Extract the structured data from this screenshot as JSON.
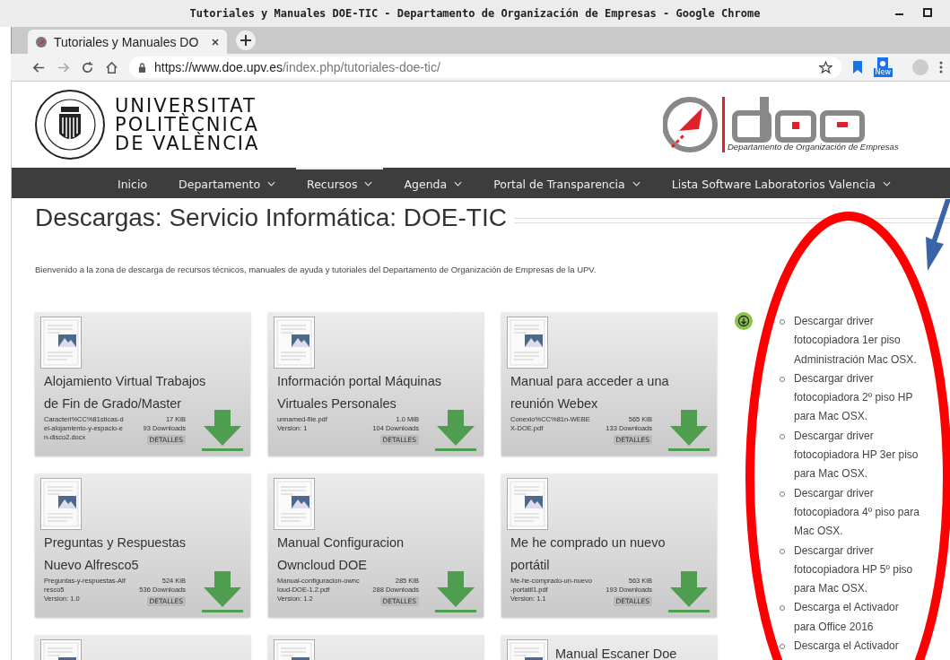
{
  "window": {
    "title": "Tutoriales y Manuales DOE-TIC - Departamento de Organización de Empresas - Google Chrome"
  },
  "tabs": [
    {
      "label": "Tutoriales y Manuales DO",
      "selected": true
    }
  ],
  "address_bar": {
    "host": "https://www.doe.upv.es",
    "path": "/index.php/tutoriales-doe-tic/"
  },
  "extension_badge": "New",
  "header": {
    "university": [
      "UNIVERSITAT",
      "POLITÈCNICA",
      "DE VALÈNCIA"
    ],
    "department": "Departamento de Organización de Empresas"
  },
  "nav": [
    {
      "label": "Inicio",
      "dropdown": false,
      "selected": false
    },
    {
      "label": "Departamento",
      "dropdown": true,
      "selected": false
    },
    {
      "label": "Recursos",
      "dropdown": true,
      "selected": true
    },
    {
      "label": "Agenda",
      "dropdown": true,
      "selected": false
    },
    {
      "label": "Portal de Transparencia",
      "dropdown": true,
      "selected": false
    },
    {
      "label": "Lista Software Laboratorios Valencia",
      "dropdown": true,
      "selected": false
    }
  ],
  "page_title": "Descargas: Servicio Informática: DOE-TIC",
  "intro": "Bienvenido a la zona de descarga de recursos técnicos, manuales de ayuda y tutoriales del Departamento de Organización de Empresas de la UPV.",
  "downloads": [
    {
      "title": "Alojamiento Virtual Trabajos de Fin de Grado/Master",
      "file": "Caracteri%CC%81sticas-del-alojamiento-y-espacio-en-disco2.docx",
      "size": "17 KiB",
      "downloads": "93 Downloads",
      "button": "DETALLES"
    },
    {
      "title": "Información portal Máquinas Virtuales Personales",
      "file": "unnamed-file.pdf",
      "size": "1.0 MiB",
      "version": "Version: 1",
      "downloads": "104 Downloads",
      "button": "DETALLES"
    },
    {
      "title": "Manual para acceder a una reunión Webex",
      "file": "Conexio%CC%81n-WEBEX-DOE.pdf",
      "size": "565 KiB",
      "downloads": "133 Downloads",
      "button": "DETALLES"
    },
    {
      "title": "Preguntas y Respuestas Nuevo Alfresco5",
      "file": "Preguntas-y-respuestas-Alfresco5",
      "size": "524 KiB",
      "version": "Version: 1.0",
      "downloads": "536 Downloads",
      "button": "DETALLES"
    },
    {
      "title": "Manual Configuracion Owncloud DOE",
      "file": "Manual-configuracion-owncloud-DOE-1.2.pdf",
      "size": "285 KiB",
      "version": "Version: 1.2",
      "downloads": "288 Downloads",
      "button": "DETALLES"
    },
    {
      "title": "Me he comprado un nuevo portátil",
      "file": "Me-he-comprado-un-nuevo-portatil1.pdf",
      "size": "563 KiB",
      "version": "Version: 1.1",
      "downloads": "193 Downloads",
      "button": "DETALLES"
    },
    {
      "kind": "thumbnail"
    },
    {
      "kind": "thumbnail"
    },
    {
      "kind": "thumbnail",
      "title": "Manual Escaner Doe"
    }
  ],
  "sidebar_links": [
    "Descargar driver fotocopiadora 1er piso Administración Mac OSX.",
    "Descargar driver fotocopiadora 2º piso HP para Mac OSX.",
    "Descargar driver fotocopiadora HP 3er piso para Mac OSX.",
    "Descargar driver fotocopiadora 4º piso para Mac OSX.",
    "Descargar driver fotocopiadora HP 5º piso para Mac OSX.",
    "Descarga el Activador para Office 2016",
    "Descarga el Activador"
  ]
}
